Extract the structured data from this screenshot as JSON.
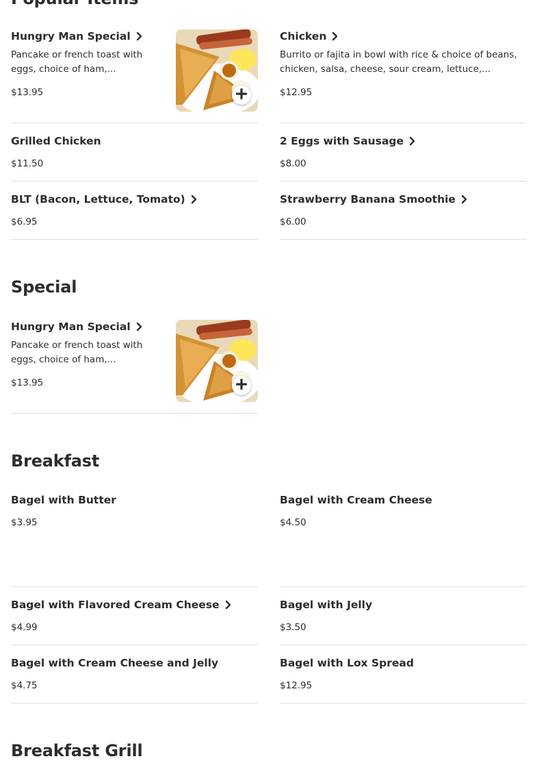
{
  "sections": {
    "popular": {
      "title": "Popular Items",
      "items": [
        {
          "name": "Hungry Man Special",
          "description": "Pancake or french toast with eggs, choice of ham,...",
          "price": "$13.95"
        },
        {
          "name": "Chicken",
          "description": "Burrito or fajita in bowl with rice & choice of beans, chicken, salsa, cheese, sour cream, lettuce,...",
          "price": "$12.95"
        },
        {
          "name": "Grilled Chicken",
          "price": "$11.50"
        },
        {
          "name": "2 Eggs with Sausage",
          "price": "$8.00"
        },
        {
          "name": "BLT (Bacon, Lettuce, Tomato)",
          "price": "$6.95"
        },
        {
          "name": "Strawberry Banana Smoothie",
          "price": "$6.00"
        }
      ]
    },
    "special": {
      "title": "Special",
      "items": [
        {
          "name": "Hungry Man Special",
          "description": "Pancake or french toast with eggs, choice of ham,...",
          "price": "$13.95"
        }
      ]
    },
    "breakfast": {
      "title": "Breakfast",
      "items": [
        {
          "name": "Bagel with Butter",
          "price": "$3.95"
        },
        {
          "name": "Bagel with Cream Cheese",
          "price": "$4.50"
        },
        {
          "name": "Bagel with Flavored Cream Cheese",
          "price": "$4.99"
        },
        {
          "name": "Bagel with Jelly",
          "price": "$3.50"
        },
        {
          "name": "Bagel with Cream Cheese and Jelly",
          "price": "$4.75"
        },
        {
          "name": "Bagel with Lox Spread",
          "price": "$12.95"
        }
      ]
    },
    "breakfast_grill": {
      "title": "Breakfast Grill"
    }
  },
  "icons": {
    "chevron": "chevron-right-icon",
    "add": "plus-icon"
  },
  "colors": {
    "text": "#2d2d2d",
    "divider": "#e0e0e0"
  }
}
